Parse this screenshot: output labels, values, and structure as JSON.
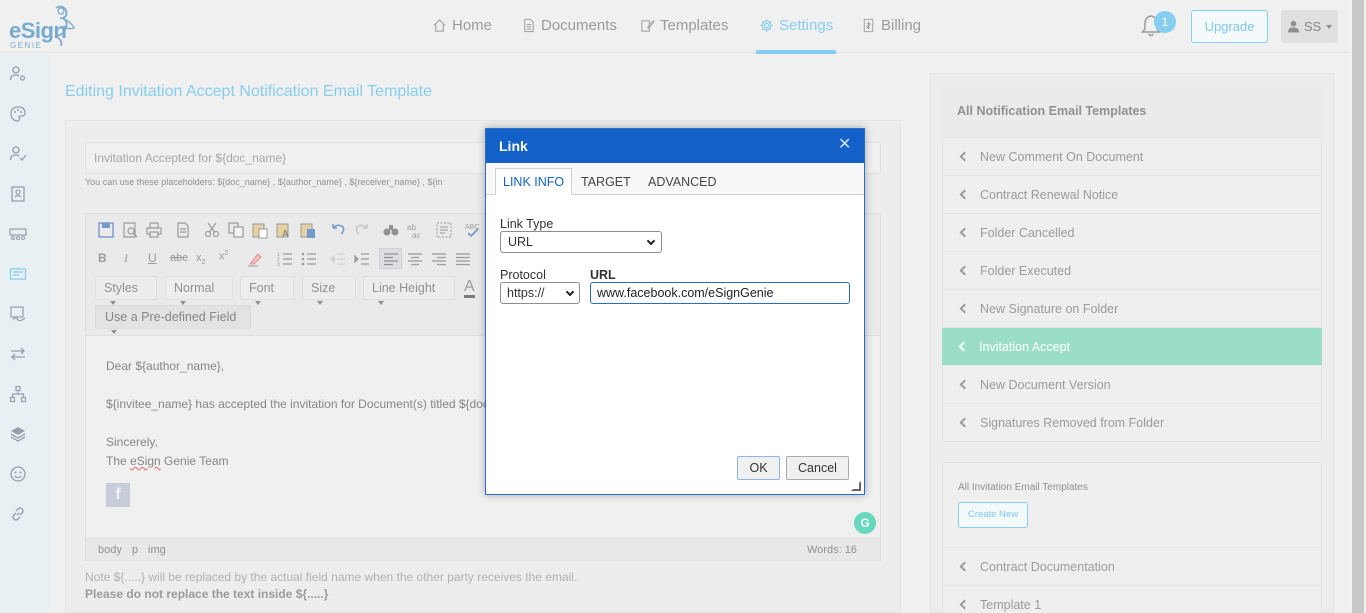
{
  "app": {
    "logo_main": "eSign",
    "logo_sub": "GENIE"
  },
  "nav": {
    "home": "Home",
    "documents": "Documents",
    "templates": "Templates",
    "settings": "Settings",
    "billing": "Billing",
    "notification_count": "1",
    "upgrade": "Upgrade",
    "user_initials": "SS"
  },
  "page": {
    "title": "Editing Invitation Accept Notification Email Template",
    "subject": "Invitation Accepted for ${doc_name}",
    "placeholder_hint": "You can use these placeholders:  ${doc_name} ,  ${author_name} ,  ${receiver_name} ,  ${in"
  },
  "toolbar": {
    "styles": "Styles",
    "format": "Normal",
    "font": "Font",
    "size": "Size",
    "line_height": "Line Height",
    "predefined": "Use a Pre-defined Field"
  },
  "email_body": {
    "greeting": "Dear ${author_name},",
    "line1": "${invitee_name} has accepted the invitation for Document(s) titled ${doc",
    "closing": "Sincerely,",
    "signature_prefix": "The ",
    "signature_brand": "eSign",
    "signature_suffix": " Genie Team"
  },
  "statusbar": {
    "path": [
      "body",
      "p",
      "img"
    ],
    "words": "Words: 16"
  },
  "notes": {
    "note1": "Note ${.....} will be replaced by the actual field name when the other party receives the email.",
    "note2": "Please do not replace the text inside ${.....}"
  },
  "right_panel": {
    "notif_header": "All Notification Email Templates",
    "notif_items": [
      "New Comment On Document",
      "Contract Renewal Notice",
      "Folder Cancelled",
      "Folder Executed",
      "New Signature on Folder",
      "Invitation Accept",
      "New Document Version",
      "Signatures Removed from Folder"
    ],
    "selected_index": 5,
    "invite_header": "All Invitation Email Templates",
    "create_new": "Create New",
    "invite_items": [
      "Contract Documentation",
      "Template 1"
    ]
  },
  "dialog": {
    "title": "Link",
    "tabs": [
      "LINK INFO",
      "TARGET",
      "ADVANCED"
    ],
    "active_tab": "LINK INFO",
    "link_type_label": "Link Type",
    "link_type_value": "URL",
    "protocol_label": "Protocol",
    "protocol_value": "https://",
    "url_label": "URL",
    "url_value": "www.facebook.com/eSignGenie",
    "ok": "OK",
    "cancel": "Cancel"
  },
  "colors": {
    "accent": "#45b4e6",
    "dialog_header": "#1360c8",
    "selected_item": "#65ccaa"
  }
}
